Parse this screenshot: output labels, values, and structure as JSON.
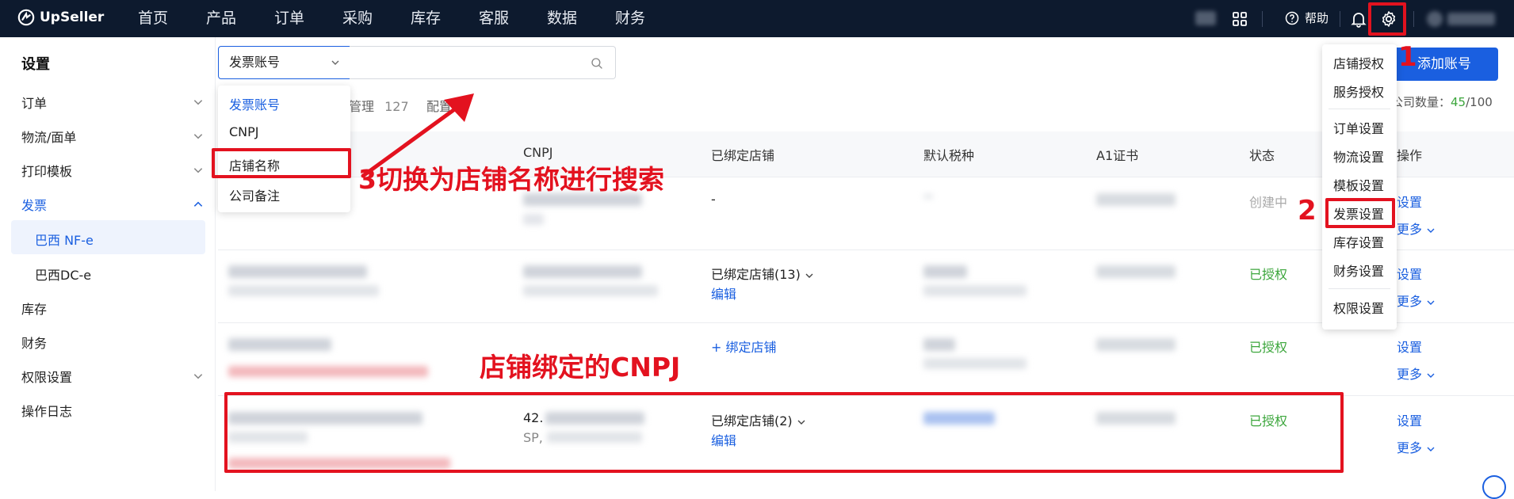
{
  "app": {
    "logo_text": "UpSeller"
  },
  "topnav": {
    "items": [
      "首页",
      "产品",
      "订单",
      "采购",
      "库存",
      "客服",
      "数据",
      "财务"
    ],
    "help_label": "帮助"
  },
  "sidebar": {
    "title": "设置",
    "items": [
      {
        "label": "订单",
        "expandable": true
      },
      {
        "label": "物流/面单",
        "expandable": true
      },
      {
        "label": "打印模板",
        "expandable": true
      },
      {
        "label": "发票",
        "expandable": true,
        "expanded": true
      },
      {
        "label": "巴西 NF-e",
        "sub": true,
        "active": true
      },
      {
        "label": "巴西DC-e",
        "sub": true
      },
      {
        "label": "库存"
      },
      {
        "label": "财务"
      },
      {
        "label": "权限设置",
        "expandable": true
      },
      {
        "label": "操作日志"
      }
    ]
  },
  "search": {
    "selected": "发票账号",
    "options": [
      "发票账号",
      "CNPJ",
      "店铺名称",
      "公司备注"
    ]
  },
  "tabs": {
    "manage_label": "管理",
    "manage_count": "127",
    "config_label": "配置"
  },
  "add_button": "添加账号",
  "company_count": {
    "label": "公司数量：",
    "used": "45",
    "total": "/100"
  },
  "table": {
    "headers": [
      "CNPJ",
      "已绑定店铺",
      "默认税种",
      "A1证书",
      "状态",
      "操作"
    ],
    "rows": [
      {
        "cnpj_prefix": "",
        "bound": "-",
        "status": "创建中",
        "status_type": "gray",
        "actions": [
          "设置",
          "更多"
        ]
      },
      {
        "cnpj_prefix": "",
        "bound": "已绑定店铺(13)",
        "bound_edit": "编辑",
        "status": "已授权",
        "status_type": "green",
        "actions": [
          "设置",
          "更多"
        ]
      },
      {
        "cnpj_prefix": "",
        "bound": "+ 绑定店铺",
        "status": "已授权",
        "status_type": "green",
        "actions": [
          "设置",
          "更多"
        ]
      },
      {
        "cnpj_prefix": "42.",
        "cnpj_sub": "SP,",
        "bound": "已绑定店铺(2)",
        "bound_edit": "编辑",
        "status": "已授权",
        "status_type": "green",
        "actions": [
          "设置",
          "更多"
        ]
      }
    ]
  },
  "settings_menu": {
    "group1": [
      "店铺授权",
      "服务授权"
    ],
    "group2": [
      "订单设置",
      "物流设置",
      "模板设置",
      "发票设置",
      "库存设置",
      "财务设置"
    ],
    "group3": [
      "权限设置"
    ]
  },
  "annotations": {
    "step1": "1",
    "step2": "2",
    "step3": "3切换为店铺名称进行搜索",
    "cnpj_note": "店铺绑定的CNPJ"
  },
  "colors": {
    "accent": "#1a5fe0",
    "annotation": "#e3121f",
    "topbar": "#0d1a2e",
    "success": "#3ca63c"
  }
}
